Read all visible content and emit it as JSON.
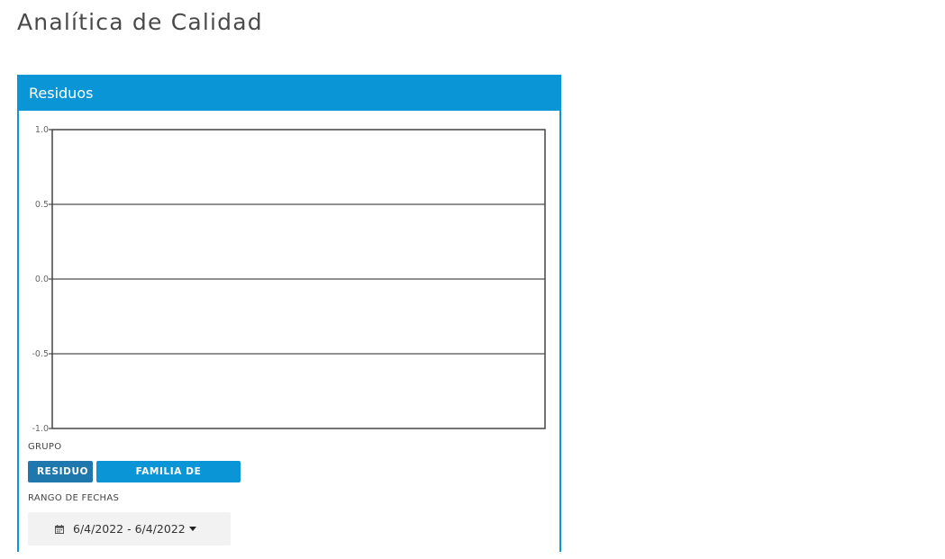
{
  "page": {
    "title": "Analítica de Calidad"
  },
  "panel": {
    "title": "Residuos",
    "accent_color": "#0a95d6"
  },
  "chart_data": {
    "type": "line",
    "title": "",
    "xlabel": "",
    "ylabel": "",
    "ylim": [
      -1.0,
      1.0
    ],
    "yticks": [
      "1.0",
      "0.5",
      "0.0",
      "-0.5",
      "-1.0"
    ],
    "series": [],
    "grid": true
  },
  "controls": {
    "group_label": "GRUPO",
    "group_buttons": [
      {
        "label": "RESIDUO",
        "active": true,
        "color": "#1f78ad"
      },
      {
        "label": "FAMILIA DE PRODUCTOS",
        "active": false,
        "color": "#0a95d6"
      }
    ],
    "date_range_label": "RANGO DE FECHAS",
    "date_range_value": "6/4/2022 - 6/4/2022",
    "date_icon": "calendar-icon",
    "caret_icon": "caret-down-icon"
  }
}
